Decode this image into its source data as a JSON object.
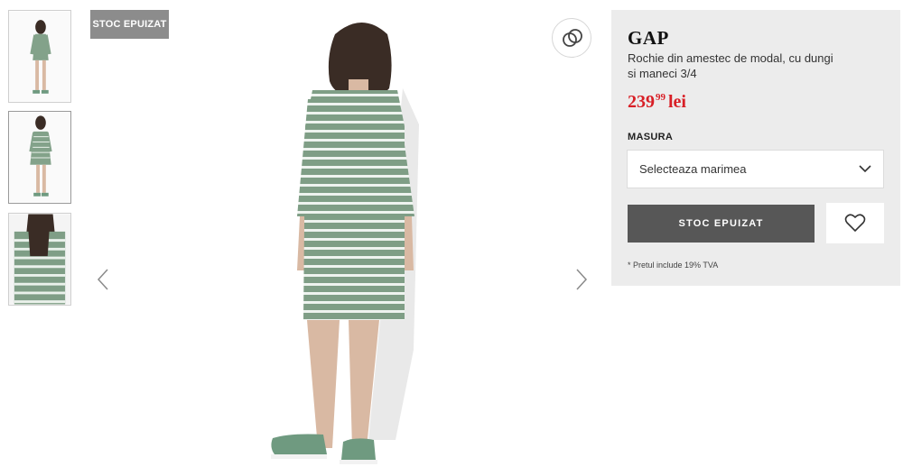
{
  "badge": {
    "label": "STOC EPUIZAT"
  },
  "thumbnails": [
    {
      "alt": "front-view"
    },
    {
      "alt": "back-view"
    },
    {
      "alt": "detail-view"
    }
  ],
  "product": {
    "brand": "GAP",
    "title": "Rochie din amestec de modal, cu dungi si maneci 3/4",
    "price": {
      "integer": "239",
      "decimals": "99",
      "currency": "lei"
    },
    "size_label": "MASURA",
    "size_select_value": "Selecteaza marimea",
    "cta_label": "STOC EPUIZAT",
    "vat_note": "* Pretul include 19% TVA"
  },
  "colors": {
    "price": "#d81f26",
    "panel_bg": "#ececec",
    "cta_bg": "#575757",
    "dress_green": "#7f9e86"
  },
  "icons": [
    "share-icon",
    "chevron-left-icon",
    "chevron-right-icon",
    "chevron-down-icon",
    "heart-icon"
  ]
}
